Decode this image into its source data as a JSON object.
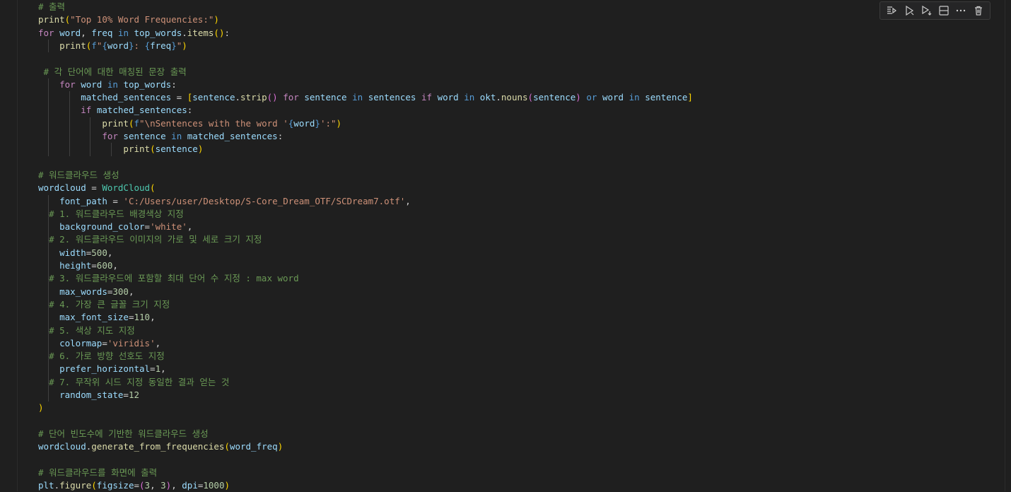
{
  "toolbar": {
    "items": [
      "execute-above-cells-icon",
      "run-cell-icon",
      "run-below-icon",
      "split-cell-icon",
      "more-actions-icon",
      "delete-cell-icon"
    ]
  },
  "code_lines": [
    [
      [
        "cm",
        "# 출력"
      ]
    ],
    [
      [
        "fn",
        "print"
      ],
      [
        "p1",
        "("
      ],
      [
        "str",
        "\"Top 10% Word Frequencies:\""
      ],
      [
        "p1",
        ")"
      ]
    ],
    [
      [
        "ctl",
        "for"
      ],
      [
        "txt",
        " "
      ],
      [
        "var",
        "word"
      ],
      [
        "txt",
        ", "
      ],
      [
        "var",
        "freq"
      ],
      [
        "txt",
        " "
      ],
      [
        "kw",
        "in"
      ],
      [
        "txt",
        " "
      ],
      [
        "var",
        "top_words"
      ],
      [
        "txt",
        "."
      ],
      [
        "fn",
        "items"
      ],
      [
        "p1",
        "()"
      ],
      [
        "txt",
        ":"
      ]
    ],
    [
      [
        "txt",
        "    "
      ],
      [
        "fn",
        "print"
      ],
      [
        "p1",
        "("
      ],
      [
        "kw",
        "f"
      ],
      [
        "str",
        "\""
      ],
      [
        "kw",
        "{"
      ],
      [
        "var",
        "word"
      ],
      [
        "kw",
        "}"
      ],
      [
        "str",
        ": "
      ],
      [
        "kw",
        "{"
      ],
      [
        "var",
        "freq"
      ],
      [
        "kw",
        "}"
      ],
      [
        "str",
        "\""
      ],
      [
        "p1",
        ")"
      ]
    ],
    [],
    [
      [
        "txt",
        " "
      ],
      [
        "cm",
        "# 각 단어에 대한 매칭된 문장 출력"
      ]
    ],
    [
      [
        "txt",
        "    "
      ],
      [
        "ctl",
        "for"
      ],
      [
        "txt",
        " "
      ],
      [
        "var",
        "word"
      ],
      [
        "txt",
        " "
      ],
      [
        "kw",
        "in"
      ],
      [
        "txt",
        " "
      ],
      [
        "var",
        "top_words"
      ],
      [
        "txt",
        ":"
      ]
    ],
    [
      [
        "txt",
        "        "
      ],
      [
        "var",
        "matched_sentences"
      ],
      [
        "txt",
        " = "
      ],
      [
        "p1",
        "["
      ],
      [
        "var",
        "sentence"
      ],
      [
        "txt",
        "."
      ],
      [
        "fn",
        "strip"
      ],
      [
        "p2",
        "()"
      ],
      [
        "txt",
        " "
      ],
      [
        "ctl",
        "for"
      ],
      [
        "txt",
        " "
      ],
      [
        "var",
        "sentence"
      ],
      [
        "txt",
        " "
      ],
      [
        "kw",
        "in"
      ],
      [
        "txt",
        " "
      ],
      [
        "var",
        "sentences"
      ],
      [
        "txt",
        " "
      ],
      [
        "ctl",
        "if"
      ],
      [
        "txt",
        " "
      ],
      [
        "var",
        "word"
      ],
      [
        "txt",
        " "
      ],
      [
        "kw",
        "in"
      ],
      [
        "txt",
        " "
      ],
      [
        "var",
        "okt"
      ],
      [
        "txt",
        "."
      ],
      [
        "fn",
        "nouns"
      ],
      [
        "p2",
        "("
      ],
      [
        "var",
        "sentence"
      ],
      [
        "p2",
        ")"
      ],
      [
        "txt",
        " "
      ],
      [
        "kw",
        "or"
      ],
      [
        "txt",
        " "
      ],
      [
        "var",
        "word"
      ],
      [
        "txt",
        " "
      ],
      [
        "kw",
        "in"
      ],
      [
        "txt",
        " "
      ],
      [
        "var",
        "sentence"
      ],
      [
        "p1",
        "]"
      ]
    ],
    [
      [
        "txt",
        "        "
      ],
      [
        "ctl",
        "if"
      ],
      [
        "txt",
        " "
      ],
      [
        "var",
        "matched_sentences"
      ],
      [
        "txt",
        ":"
      ]
    ],
    [
      [
        "txt",
        "            "
      ],
      [
        "fn",
        "print"
      ],
      [
        "p1",
        "("
      ],
      [
        "kw",
        "f"
      ],
      [
        "str",
        "\""
      ],
      [
        "str",
        "\\n"
      ],
      [
        "str",
        "Sentences with the word '"
      ],
      [
        "kw",
        "{"
      ],
      [
        "var",
        "word"
      ],
      [
        "kw",
        "}"
      ],
      [
        "str",
        "':\""
      ],
      [
        "p1",
        ")"
      ]
    ],
    [
      [
        "txt",
        "            "
      ],
      [
        "ctl",
        "for"
      ],
      [
        "txt",
        " "
      ],
      [
        "var",
        "sentence"
      ],
      [
        "txt",
        " "
      ],
      [
        "kw",
        "in"
      ],
      [
        "txt",
        " "
      ],
      [
        "var",
        "matched_sentences"
      ],
      [
        "txt",
        ":"
      ]
    ],
    [
      [
        "txt",
        "                "
      ],
      [
        "fn",
        "print"
      ],
      [
        "p1",
        "("
      ],
      [
        "var",
        "sentence"
      ],
      [
        "p1",
        ")"
      ]
    ],
    [],
    [
      [
        "cm",
        "# 워드클라우드 생성"
      ]
    ],
    [
      [
        "var",
        "wordcloud"
      ],
      [
        "txt",
        " = "
      ],
      [
        "cls",
        "WordCloud"
      ],
      [
        "p1",
        "("
      ]
    ],
    [
      [
        "txt",
        "    "
      ],
      [
        "var",
        "font_path"
      ],
      [
        "txt",
        " = "
      ],
      [
        "str",
        "'C:/Users/user/Desktop/S-Core_Dream_OTF/SCDream7.otf'"
      ],
      [
        "txt",
        ","
      ]
    ],
    [
      [
        "txt",
        "  "
      ],
      [
        "cm",
        "# 1. 워드클라우드 배경색상 지정"
      ]
    ],
    [
      [
        "txt",
        "    "
      ],
      [
        "var",
        "background_color"
      ],
      [
        "txt",
        "="
      ],
      [
        "str",
        "'white'"
      ],
      [
        "txt",
        ","
      ]
    ],
    [
      [
        "txt",
        "  "
      ],
      [
        "cm",
        "# 2. 워드클라우드 이미지의 가로 및 세로 크기 지정"
      ]
    ],
    [
      [
        "txt",
        "    "
      ],
      [
        "var",
        "width"
      ],
      [
        "txt",
        "="
      ],
      [
        "num",
        "500"
      ],
      [
        "txt",
        ","
      ]
    ],
    [
      [
        "txt",
        "    "
      ],
      [
        "var",
        "height"
      ],
      [
        "txt",
        "="
      ],
      [
        "num",
        "600"
      ],
      [
        "txt",
        ","
      ]
    ],
    [
      [
        "txt",
        "  "
      ],
      [
        "cm",
        "# 3. 워드클라우드에 포함할 최대 단어 수 지정 : max word"
      ]
    ],
    [
      [
        "txt",
        "    "
      ],
      [
        "var",
        "max_words"
      ],
      [
        "txt",
        "="
      ],
      [
        "num",
        "300"
      ],
      [
        "txt",
        ","
      ]
    ],
    [
      [
        "txt",
        "  "
      ],
      [
        "cm",
        "# 4. 가장 큰 글꼴 크기 지정"
      ]
    ],
    [
      [
        "txt",
        "    "
      ],
      [
        "var",
        "max_font_size"
      ],
      [
        "txt",
        "="
      ],
      [
        "num",
        "110"
      ],
      [
        "txt",
        ","
      ]
    ],
    [
      [
        "txt",
        "  "
      ],
      [
        "cm",
        "# 5. 색상 지도 지정"
      ]
    ],
    [
      [
        "txt",
        "    "
      ],
      [
        "var",
        "colormap"
      ],
      [
        "txt",
        "="
      ],
      [
        "str",
        "'viridis'"
      ],
      [
        "txt",
        ","
      ]
    ],
    [
      [
        "txt",
        "  "
      ],
      [
        "cm",
        "# 6. 가로 방향 선호도 지정"
      ]
    ],
    [
      [
        "txt",
        "    "
      ],
      [
        "var",
        "prefer_horizontal"
      ],
      [
        "txt",
        "="
      ],
      [
        "num",
        "1"
      ],
      [
        "txt",
        ","
      ]
    ],
    [
      [
        "txt",
        "  "
      ],
      [
        "cm",
        "# 7. 무작위 시드 지정 동일한 결과 얻는 것"
      ]
    ],
    [
      [
        "txt",
        "    "
      ],
      [
        "var",
        "random_state"
      ],
      [
        "txt",
        "="
      ],
      [
        "num",
        "12"
      ]
    ],
    [
      [
        "p1",
        ")"
      ]
    ],
    [],
    [
      [
        "cm",
        "# 단어 빈도수에 기반한 워드클라우드 생성"
      ]
    ],
    [
      [
        "var",
        "wordcloud"
      ],
      [
        "txt",
        "."
      ],
      [
        "fn",
        "generate_from_frequencies"
      ],
      [
        "p1",
        "("
      ],
      [
        "var",
        "word_freq"
      ],
      [
        "p1",
        ")"
      ]
    ],
    [],
    [
      [
        "cm",
        "# 워드클라우드를 화면에 출력"
      ]
    ],
    [
      [
        "var",
        "plt"
      ],
      [
        "txt",
        "."
      ],
      [
        "fn",
        "figure"
      ],
      [
        "p1",
        "("
      ],
      [
        "var",
        "figsize"
      ],
      [
        "txt",
        "="
      ],
      [
        "p2",
        "("
      ],
      [
        "num",
        "3"
      ],
      [
        "txt",
        ", "
      ],
      [
        "num",
        "3"
      ],
      [
        "p2",
        ")"
      ],
      [
        "txt",
        ", "
      ],
      [
        "var",
        "dpi"
      ],
      [
        "txt",
        "="
      ],
      [
        "num",
        "1000"
      ],
      [
        "p1",
        ")"
      ]
    ]
  ]
}
